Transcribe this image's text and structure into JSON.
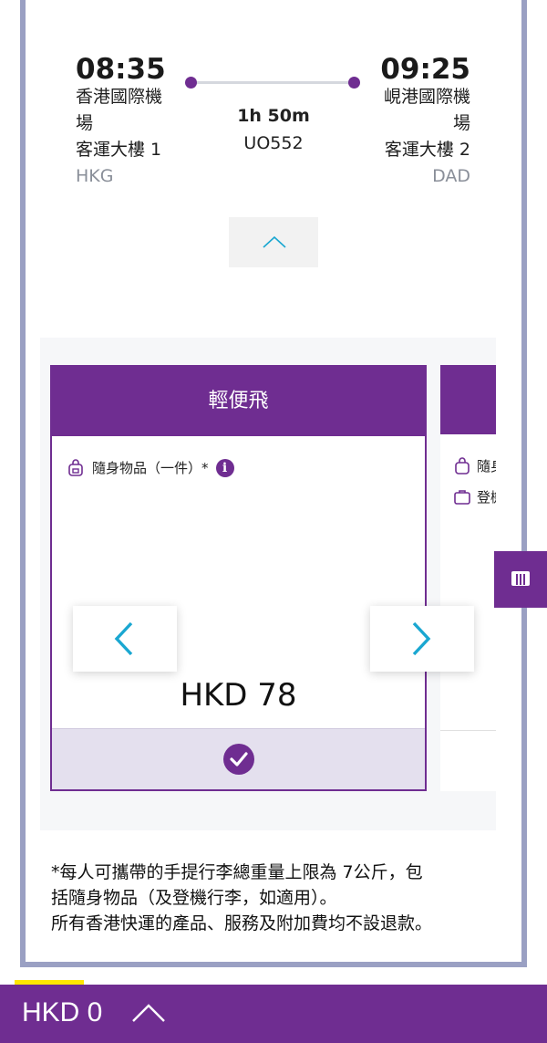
{
  "flight": {
    "departure": {
      "time": "08:35",
      "airport_line1": "香港國際機",
      "airport_line2": "場",
      "terminal": "客運大樓 1",
      "code": "HKG"
    },
    "arrival": {
      "time": "09:25",
      "airport_line1": "峴港國際機",
      "airport_line2": "場",
      "terminal": "客運大樓 2",
      "code": "DAD"
    },
    "duration": "1h 50m",
    "flight_number": "UO552"
  },
  "fare_card": {
    "title": "輕便飛",
    "feature": "隨身物品（一件）*",
    "info_icon": "i",
    "price": "HKD 78",
    "selected": true
  },
  "next_card": {
    "feature1": "隨身",
    "feature2": "登機"
  },
  "note": {
    "line1": "*每人可攜帶的手提行李總重量上限為 7公斤，包",
    "line2": "括隨身物品（及登機行李，如適用）。",
    "line3": "所有香港快運的產品、服務及附加費均不設退款。"
  },
  "total": {
    "amount": "HKD 0"
  },
  "colors": {
    "brand": "#6f2d91",
    "accent": "#1aa7d1",
    "frame": "#9aa0c3",
    "highlight": "#ffe600"
  },
  "icons": [
    "backpack-icon",
    "info-icon",
    "chevron-up-icon",
    "chevron-left-icon",
    "chevron-right-icon",
    "checkmark-icon",
    "luggage-icon",
    "columns-icon"
  ]
}
